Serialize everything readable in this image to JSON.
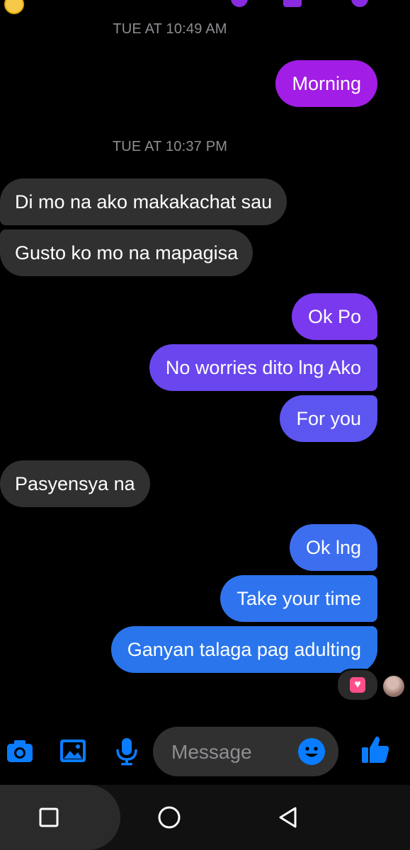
{
  "header": {
    "emoji": "😩"
  },
  "timestamps": {
    "first": "TUE AT 10:49 AM",
    "second": "TUE AT 10:37 PM"
  },
  "messages": [
    {
      "dir": "out",
      "text": "Morning",
      "color": "#a21de6"
    },
    {
      "dir": "in",
      "text": "Di mo na ako makakachat sau"
    },
    {
      "dir": "in",
      "text": "Gusto ko mo na mapagisa"
    },
    {
      "dir": "out",
      "text": "Ok Po",
      "color": "#7a39ee"
    },
    {
      "dir": "out",
      "text": "No worries dito lng Ako",
      "color": "#6a46ef"
    },
    {
      "dir": "out",
      "text": "For you",
      "color": "#5c55f0"
    },
    {
      "dir": "in",
      "text": "Pasyensya na"
    },
    {
      "dir": "out",
      "text": "Ok lng",
      "color": "#3d6ef0"
    },
    {
      "dir": "out",
      "text": "Take your time",
      "color": "#2f74ee"
    },
    {
      "dir": "out",
      "text": "Ganyan talaga pag adulting",
      "color": "#2a75ec"
    }
  ],
  "reaction": {
    "icon": "heart-icon"
  },
  "composer": {
    "placeholder": "Message",
    "icons": [
      "camera-icon",
      "gallery-icon",
      "microphone-icon",
      "emoji-icon",
      "thumbs-up-icon"
    ],
    "accent": "#0a7cff"
  },
  "navbar": {
    "icons": [
      "recents-icon",
      "home-icon",
      "back-icon"
    ]
  }
}
